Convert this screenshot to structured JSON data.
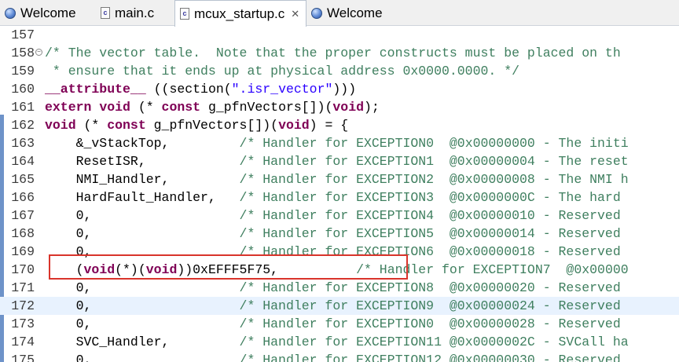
{
  "tabs": [
    {
      "label": "Welcome",
      "icon": "globe-icon",
      "active": false
    },
    {
      "label": "main.c",
      "icon": "c-file-icon",
      "active": false
    },
    {
      "label": "mcux_startup.c",
      "icon": "c-file-icon",
      "active": true,
      "close": "✕"
    },
    {
      "label": "Welcome",
      "icon": "globe-icon",
      "active": false
    }
  ],
  "editor": {
    "highlighted_line": "172",
    "annotation_color": "#d9342b",
    "lines": [
      {
        "n": "157",
        "t": ""
      },
      {
        "n": "158",
        "t": "/* The vector table.  Note that the proper constructs must be placed on th"
      },
      {
        "n": "159",
        "t": " * ensure that it ends up at physical address 0x0000.0000. */"
      },
      {
        "n": "160",
        "p1": "__attribute__",
        "p2": " ((section(",
        "p3": "\".isr_vector\"",
        "p4": ")))"
      },
      {
        "n": "161",
        "p1": "extern",
        "p2": " ",
        "p3": "void",
        "p4": " (* ",
        "p5": "const",
        "p6": " g_pfnVectors[])(",
        "p7": "void",
        "p8": ");"
      },
      {
        "n": "162",
        "p1": "void",
        "p2": " (* ",
        "p3": "const",
        "p4": " g_pfnVectors[])(",
        "p5": "void",
        "p6": ") = {"
      },
      {
        "n": "163",
        "c": "    &_vStackTop,         ",
        "m": "/* Handler for EXCEPTION0  @0x00000000 - The initi"
      },
      {
        "n": "164",
        "c": "    ResetISR,            ",
        "m": "/* Handler for EXCEPTION1  @0x00000004 - The reset"
      },
      {
        "n": "165",
        "c": "    NMI_Handler,         ",
        "m": "/* Handler for EXCEPTION2  @0x00000008 - The NMI h"
      },
      {
        "n": "166",
        "c": "    HardFault_Handler,   ",
        "m": "/* Handler for EXCEPTION3  @0x0000000C - The hard"
      },
      {
        "n": "167",
        "c": "    0,                   ",
        "m": "/* Handler for EXCEPTION4  @0x00000010 - Reserved"
      },
      {
        "n": "168",
        "c": "    0,                   ",
        "m": "/* Handler for EXCEPTION5  @0x00000014 - Reserved"
      },
      {
        "n": "169",
        "c": "    0,                   ",
        "m": "/* Handler for EXCEPTION6  @0x00000018 - Reserved"
      },
      {
        "n": "170",
        "p1": "    (",
        "p2": "void",
        "p3": "(*)(",
        "p4": "void",
        "p5": "))0xEFFF5F75,          ",
        "p6": "/* Handler for EXCEPTION7  @0x00000"
      },
      {
        "n": "171",
        "c": "    0,                   ",
        "m": "/* Handler for EXCEPTION8  @0x00000020 - Reserved"
      },
      {
        "n": "172",
        "c": "    0,                   ",
        "m": "/* Handler for EXCEPTION9  @0x00000024 - Reserved"
      },
      {
        "n": "173",
        "c": "    0,                   ",
        "m": "/* Handler for EXCEPTION0  @0x00000028 - Reserved"
      },
      {
        "n": "174",
        "c": "    SVC_Handler,         ",
        "m": "/* Handler for EXCEPTION11 @0x0000002C - SVCall ha"
      },
      {
        "n": "175",
        "c": "    0,                   ",
        "m": "/* Handler for EXCEPTION12 @0x00000030 - Reserved"
      }
    ]
  }
}
